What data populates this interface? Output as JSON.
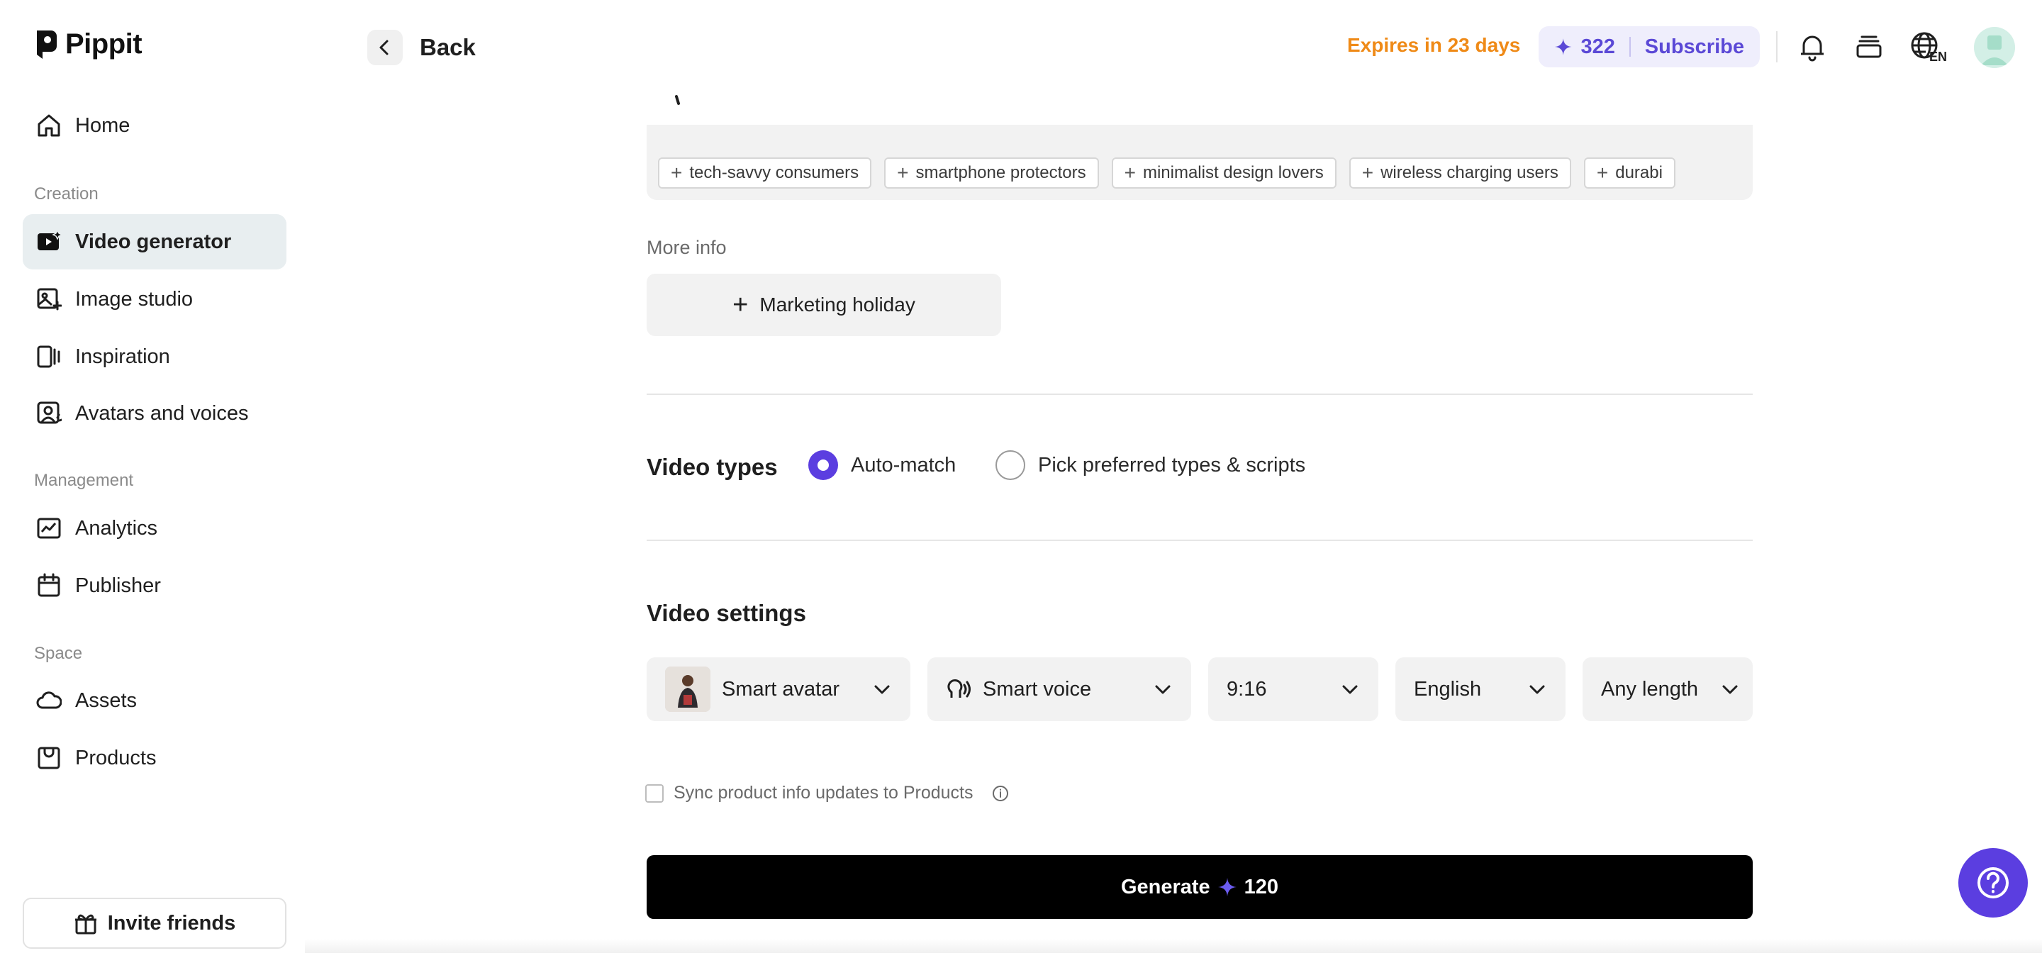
{
  "brand": {
    "name": "Pippit"
  },
  "sidebar": {
    "items_top": [
      {
        "label": "Home",
        "icon": "home-icon"
      }
    ],
    "sections": [
      {
        "label": "Creation",
        "items": [
          {
            "label": "Video generator",
            "icon": "video-generator-icon",
            "active": true
          },
          {
            "label": "Image studio",
            "icon": "image-studio-icon"
          },
          {
            "label": "Inspiration",
            "icon": "inspiration-icon"
          },
          {
            "label": "Avatars and voices",
            "icon": "avatar-icon"
          }
        ]
      },
      {
        "label": "Management",
        "items": [
          {
            "label": "Analytics",
            "icon": "analytics-icon"
          },
          {
            "label": "Publisher",
            "icon": "calendar-icon"
          }
        ]
      },
      {
        "label": "Space",
        "items": [
          {
            "label": "Assets",
            "icon": "cloud-icon"
          },
          {
            "label": "Products",
            "icon": "products-icon"
          }
        ]
      }
    ],
    "invite_label": "Invite friends"
  },
  "topbar": {
    "back_label": "Back",
    "expires": "Expires in 23 days",
    "credits": "322",
    "subscribe": "Subscribe",
    "language_badge": "EN"
  },
  "audience": {
    "tags": [
      "tech-savvy consumers",
      "smartphone protectors",
      "minimalist design lovers",
      "wireless charging users",
      "durabi"
    ]
  },
  "more_info": {
    "label": "More info",
    "holiday_button": "Marketing holiday"
  },
  "video_types": {
    "title": "Video types",
    "options": [
      {
        "label": "Auto-match",
        "selected": true
      },
      {
        "label": "Pick preferred types & scripts",
        "selected": false
      }
    ]
  },
  "video_settings": {
    "title": "Video settings",
    "avatar": "Smart avatar",
    "voice": "Smart voice",
    "ratio": "9:16",
    "language": "English",
    "length": "Any length"
  },
  "sync": {
    "label": "Sync product info updates to Products",
    "checked": false
  },
  "generate": {
    "label": "Generate",
    "cost": "120"
  },
  "colors": {
    "accent": "#5b3ee0",
    "expires": "#ef8a17",
    "active_bg": "#e8eef0"
  }
}
